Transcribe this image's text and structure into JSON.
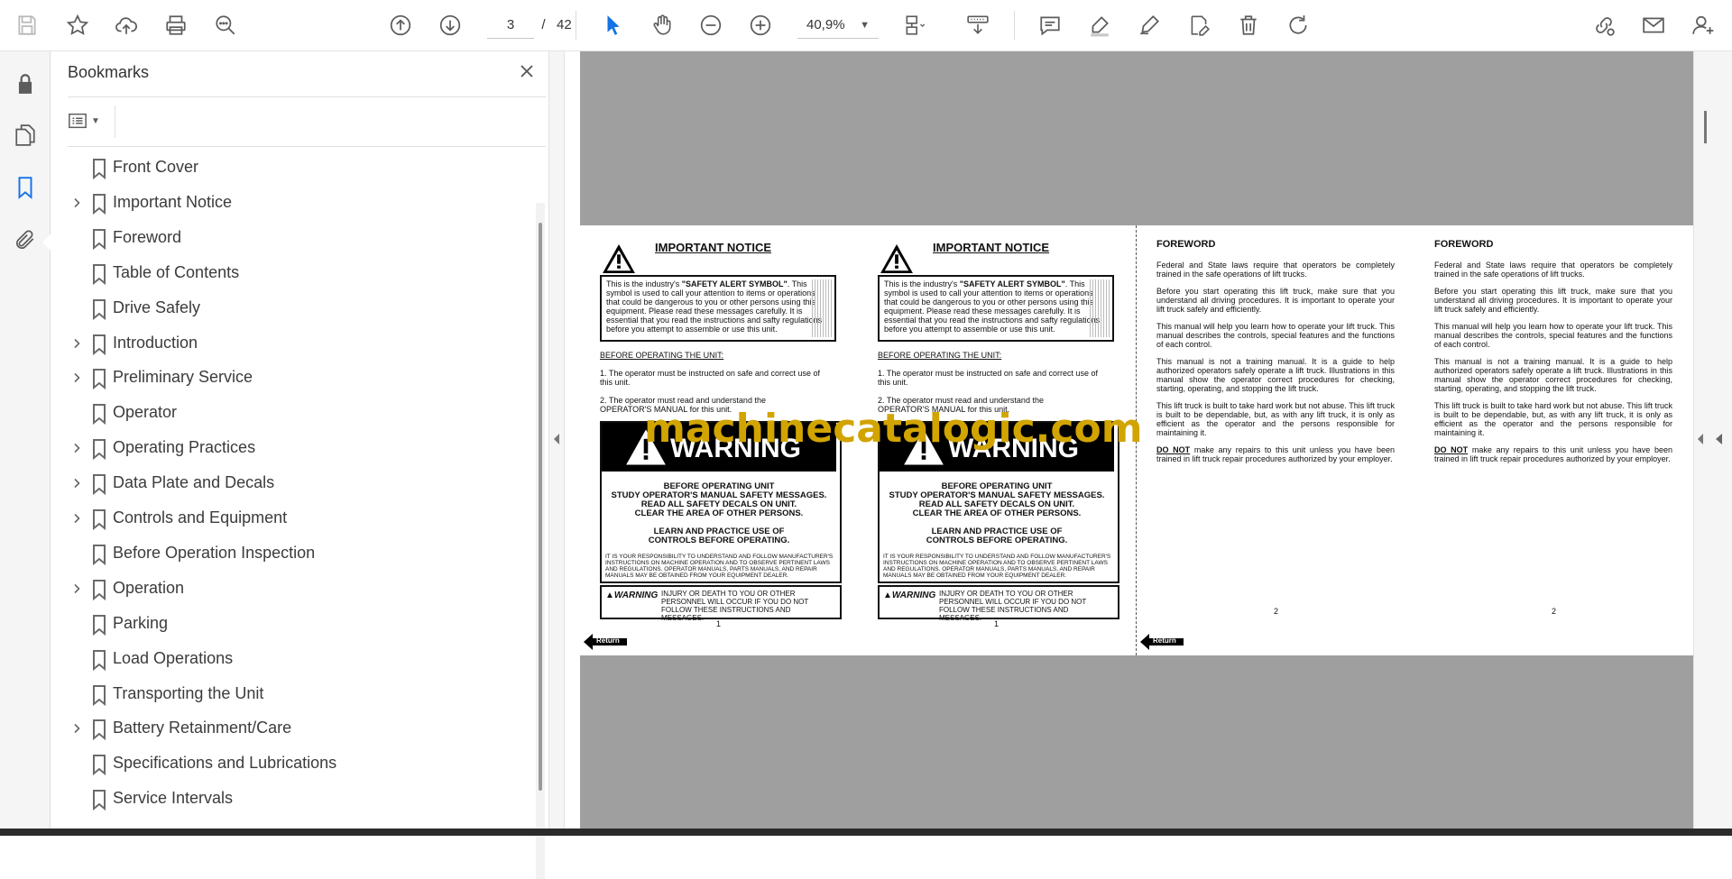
{
  "toolbar": {
    "icons": [
      "save-icon",
      "star-icon",
      "upload-icon",
      "print-icon",
      "find-icon",
      "page-up-icon",
      "page-down-icon",
      "select-cursor-icon",
      "hand-icon",
      "zoom-out-icon",
      "zoom-in-icon",
      "page-layout-icon",
      "scroll-mode-icon",
      "comment-icon",
      "highlight-icon",
      "draw-icon",
      "fill-sign-icon",
      "delete-icon",
      "rotate-icon",
      "share-link-icon",
      "email-icon",
      "account-icon"
    ],
    "current_page": "3",
    "page_separator": "/",
    "total_pages": "42",
    "zoom": "40,9%"
  },
  "sidebar_tools": [
    "lock-icon",
    "pages-icon",
    "bookmark-icon",
    "attachment-icon"
  ],
  "bookmarks": {
    "title": "Bookmarks",
    "items": [
      {
        "label": "Front Cover",
        "expandable": false
      },
      {
        "label": "Important Notice",
        "expandable": true
      },
      {
        "label": "Foreword",
        "expandable": false
      },
      {
        "label": "Table of Contents",
        "expandable": false
      },
      {
        "label": "Drive Safely",
        "expandable": false
      },
      {
        "label": "Introduction",
        "expandable": true
      },
      {
        "label": "Preliminary Service",
        "expandable": true
      },
      {
        "label": "Operator",
        "expandable": false
      },
      {
        "label": "Operating Practices",
        "expandable": true
      },
      {
        "label": "Data Plate and Decals",
        "expandable": true
      },
      {
        "label": "Controls and Equipment",
        "expandable": true
      },
      {
        "label": "Before Operation Inspection",
        "expandable": false
      },
      {
        "label": "Operation",
        "expandable": true
      },
      {
        "label": "Parking",
        "expandable": false
      },
      {
        "label": "Load Operations",
        "expandable": false
      },
      {
        "label": "Transporting the Unit",
        "expandable": false
      },
      {
        "label": "Battery Retainment/Care",
        "expandable": true
      },
      {
        "label": "Specifications and Lubrications",
        "expandable": false
      },
      {
        "label": "Service Intervals",
        "expandable": false
      }
    ]
  },
  "document": {
    "watermark": "machinecatalogic.com",
    "notice_pages": [
      {
        "title": "IMPORTANT NOTICE",
        "safety_box_pre": "This is the industry's ",
        "safety_box_bold": "\"SAFETY ALERT SYMBOL\"",
        "safety_box_post": ". This symbol is used to call your attention to items or operations that could be dangerous to you or other persons using this equipment. Please read these messages carefully. It is essential that you read the instructions and safty regulations before you attempt to assemble or use this unit.",
        "before_heading": "BEFORE OPERATING THE UNIT:",
        "item1": "1. The operator must be instructed on safe and correct use of this unit.",
        "item2": "2. The operator must read and understand the OPERATOR'S MANUAL for this unit.",
        "warning_word": "WARNING",
        "warning_lines": [
          "BEFORE OPERATING UNIT",
          "STUDY OPERATOR'S MANUAL SAFETY MESSAGES.",
          "READ ALL SAFETY DECALS ON UNIT.",
          "CLEAR THE AREA OF OTHER PERSONS."
        ],
        "learn_lines": [
          "LEARN AND PRACTICE USE OF",
          "CONTROLS BEFORE OPERATING."
        ],
        "fine_print": "IT IS YOUR RESPONSIBILITY TO UNDERSTAND AND FOLLOW MANUFACTURER'S INSTRUCTIONS ON MACHINE OPERATION AND TO OBSERVE PERTINENT LAWS AND REGULATIONS. OPERATOR MANUALS, PARTS MANUALS, AND REPAIR MANUALS MAY BE OBTAINED FROM YOUR EQUIPMENT DEALER.",
        "mini_warning": "WARNING",
        "injury_text": "INJURY OR DEATH TO YOU OR OTHER PERSONNEL WILL OCCUR IF YOU DO NOT FOLLOW THESE INSTRUCTIONS AND MESSAGES.",
        "page_number": "1",
        "return_label": "Return"
      },
      {
        "title": "IMPORTANT NOTICE",
        "safety_box_pre": "This is the industry's ",
        "safety_box_bold": "\"SAFETY ALERT SYMBOL\"",
        "safety_box_post": ". This symbol is used to call your attention to items or operations that could be dangerous to you or other persons using this equipment. Please read these messages carefully. It is essential that you read the instructions and safty regulations before you attempt to assemble or use this unit.",
        "before_heading": "BEFORE OPERATING THE UNIT:",
        "item1": "1. The operator must be instructed on safe and correct use of this unit.",
        "item2": "2. The operator must read and understand the OPERATOR'S MANUAL for this unit.",
        "warning_word": "WARNING",
        "warning_lines": [
          "BEFORE OPERATING UNIT",
          "STUDY OPERATOR'S MANUAL SAFETY MESSAGES.",
          "READ ALL SAFETY DECALS ON UNIT.",
          "CLEAR THE AREA OF OTHER PERSONS."
        ],
        "learn_lines": [
          "LEARN AND PRACTICE USE OF",
          "CONTROLS BEFORE OPERATING."
        ],
        "fine_print": "IT IS YOUR RESPONSIBILITY TO UNDERSTAND AND FOLLOW MANUFACTURER'S INSTRUCTIONS ON MACHINE OPERATION AND TO OBSERVE PERTINENT LAWS AND REGULATIONS. OPERATOR MANUALS, PARTS MANUALS, AND REPAIR MANUALS MAY BE OBTAINED FROM YOUR EQUIPMENT DEALER.",
        "mini_warning": "WARNING",
        "injury_text": "INJURY OR DEATH TO YOU OR OTHER PERSONNEL WILL OCCUR IF YOU DO NOT FOLLOW THESE INSTRUCTIONS AND MESSAGES.",
        "page_number": "1"
      }
    ],
    "foreword_pages": [
      {
        "title": "FOREWORD",
        "p1": "Federal and State laws require that operators be completely trained in the safe operations of lift trucks.",
        "p2": "Before you start operating this lift truck, make sure that you understand all driving procedures. It is important to operate your lift truck safely and efficiently.",
        "p3": "This manual will help you learn how to operate your lift truck. This manual describes the controls, special features and the functions of each control.",
        "p4": "This manual is not a training manual. It is a guide to help authorized operators safely operate a lift truck. Illustrations in this manual show the operator correct procedures for checking, starting, operating, and stopping the lift truck.",
        "p5": "This lift truck is built to take hard work but not abuse. This lift truck is built to be dependable, but, as with any lift truck, it is only as efficient as the operator and the persons responsible for maintaining it.",
        "p6_bold": "DO NOT",
        "p6_rest": " make any repairs to this unit unless you have been trained in lift truck repair procedures authorized by your employer.",
        "page_number": "2",
        "return_label": "Return"
      },
      {
        "title": "FOREWORD",
        "p1": "Federal and State laws require that operators be completely trained in the safe operations of lift trucks.",
        "p2": "Before you start operating this lift truck, make sure that you understand all driving procedures. It is important to operate your lift truck safely and efficiently.",
        "p3": "This manual will help you learn how to operate your lift truck. This manual describes the controls, special features and the functions of each control.",
        "p4": "This manual is not a training manual. It is a guide to help authorized operators safely operate a lift truck. Illustrations in this manual show the operator correct procedures for checking, starting, operating, and stopping the lift truck.",
        "p5": "This lift truck is built to take hard work but not abuse. This lift truck is built to be dependable, but, as with any lift truck, it is only as efficient as the operator and the persons responsible for maintaining it.",
        "p6_bold": "DO NOT",
        "p6_rest": " make any repairs to this unit unless you have been trained in lift truck repair procedures authorized by your employer.",
        "page_number": "2"
      }
    ]
  },
  "colors": {
    "accent": "#1473e6",
    "watermark": "#d1a400",
    "viewport_bg": "#9f9f9f"
  }
}
